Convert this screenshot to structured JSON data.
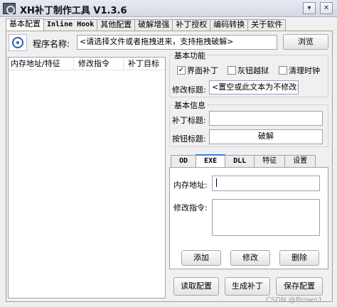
{
  "window": {
    "title": "XH补丁制作工具 V1.3.6",
    "min_glyph": "▾",
    "close_glyph": "✕"
  },
  "tabs": [
    {
      "label": "基本配置",
      "active": true
    },
    {
      "label": "Inline Hook"
    },
    {
      "label": "其他配置"
    },
    {
      "label": "破解增强"
    },
    {
      "label": "补丁授权"
    },
    {
      "label": "编码转换"
    },
    {
      "label": "关于软件"
    }
  ],
  "program": {
    "label": "程序名称:",
    "placeholder": "<请选择文件或者拖拽进来，支持拖拽破解>",
    "browse_label": "浏览"
  },
  "list": {
    "columns": [
      "内存地址/特征",
      "修改指令",
      "补丁目标"
    ]
  },
  "basic_func": {
    "title": "基本功能",
    "checkboxes": [
      {
        "label": "界面补丁",
        "checked": true,
        "mark": "✓"
      },
      {
        "label": "灰钮越狱",
        "checked": false,
        "mark": ""
      },
      {
        "label": "清理时钟",
        "checked": false,
        "mark": ""
      }
    ],
    "modify_title_label": "修改标题:",
    "modify_title_value": "<置空或此文本为不修改>"
  },
  "basic_info": {
    "title": "基本信息",
    "patch_title_label": "补丁标题:",
    "patch_title_value": "",
    "button_title_label": "按钮标题:",
    "button_title_value": "破解"
  },
  "inner_tabs": [
    {
      "label": "OD"
    },
    {
      "label": "EXE",
      "active": true
    },
    {
      "label": "DLL"
    },
    {
      "label": "特征"
    },
    {
      "label": "设置"
    }
  ],
  "exe": {
    "address_label": "内存地址:",
    "address_value": "",
    "instr_label": "修改指令:",
    "instr_value": "",
    "add_label": "添加",
    "modify_label": "修改",
    "delete_label": "删除"
  },
  "bottom": {
    "read_label": "读取配置",
    "gen_label": "生成补丁",
    "save_label": "保存配置"
  },
  "watermark": "CSDN @Brown1."
}
